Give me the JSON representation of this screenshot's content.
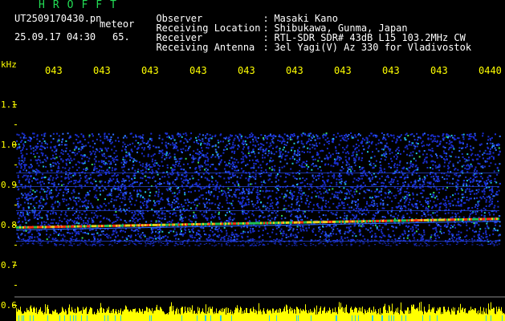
{
  "header": {
    "logo": "HROFFT",
    "filename": "UT2509170430.pn",
    "tag": "meteor",
    "date": "25.09.17 04:30",
    "value": "65."
  },
  "meta": [
    {
      "key": "Observer",
      "value": "Masaki Kano"
    },
    {
      "key": "Receiving Location",
      "value": "Shibukawa, Gunma, Japan"
    },
    {
      "key": "Receiver",
      "value": "RTL-SDR SDR# 43dB L15 103.2MHz CW"
    },
    {
      "key": "Receiving Antenna",
      "value": "3el Yagi(V) Az 330 for Vladivostok"
    }
  ],
  "axis": {
    "unit": "kHz",
    "time_labels": [
      "043",
      "043",
      "043",
      "043",
      "043",
      "043",
      "043",
      "043",
      "043",
      "0440"
    ],
    "freq_labels": [
      "1.1",
      "1.0",
      "0.9",
      "0.8",
      "0.7",
      "0.6"
    ]
  },
  "colors": {
    "axis_text": "#ffff00",
    "text": "#ffffff",
    "logo": "#22dd55",
    "noise": "#1a2fd0",
    "signal": "#ff3010",
    "amplitude": "#ffff00"
  }
}
